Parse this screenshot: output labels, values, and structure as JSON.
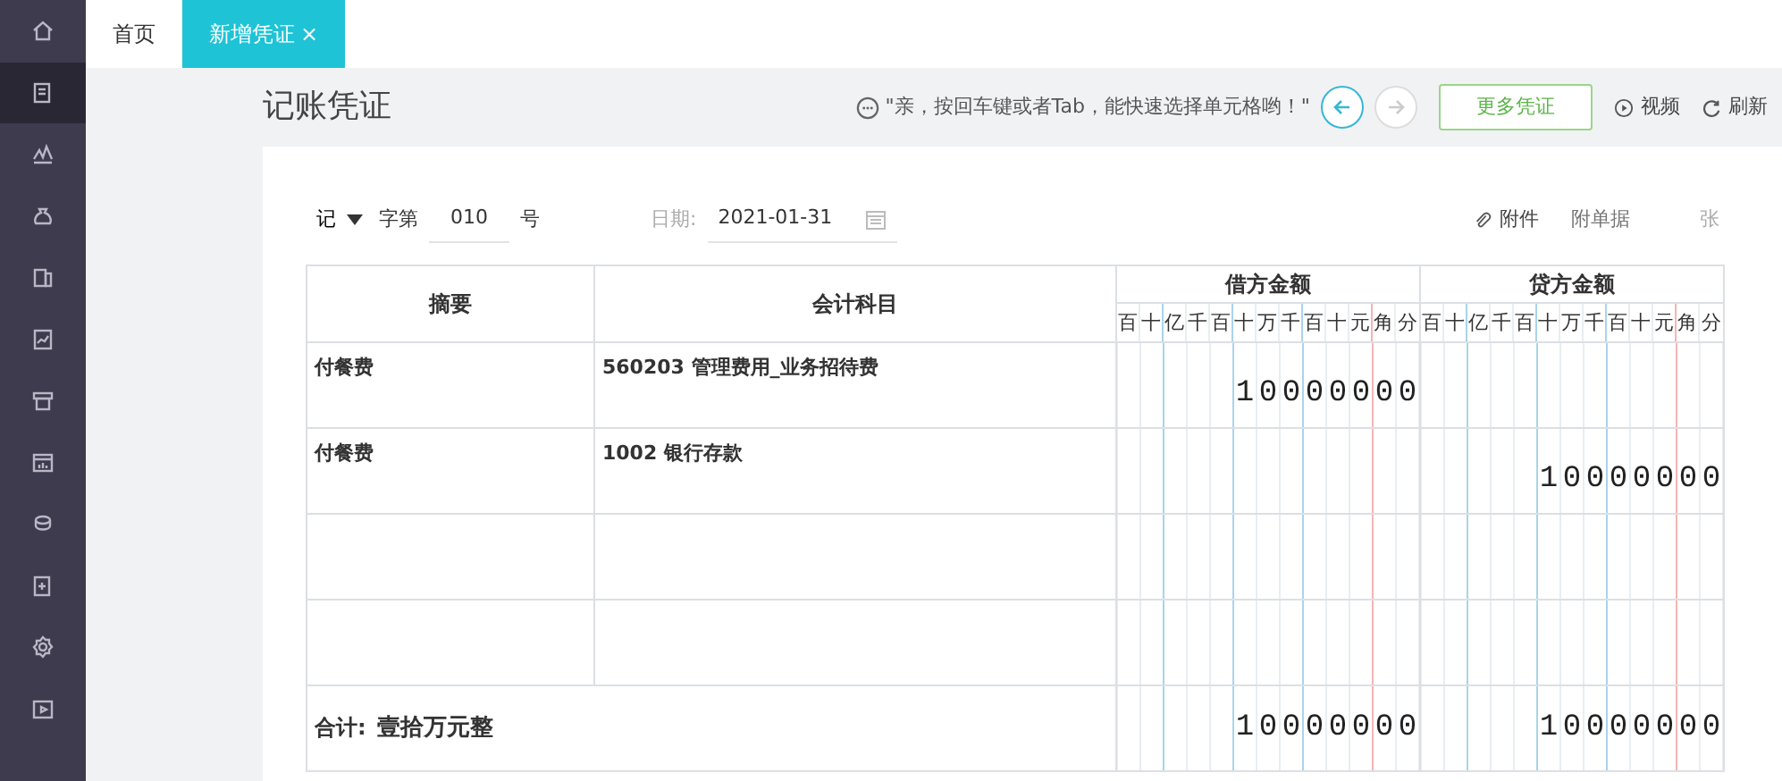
{
  "sidebar": {
    "items": [
      {
        "selected": false
      },
      {
        "selected": true
      },
      {
        "selected": false
      },
      {
        "selected": false
      },
      {
        "selected": false
      },
      {
        "selected": false
      },
      {
        "selected": false
      },
      {
        "selected": false
      },
      {
        "selected": false
      },
      {
        "selected": false
      },
      {
        "selected": false
      },
      {
        "selected": false
      }
    ]
  },
  "tabs": [
    {
      "label": "首页",
      "selected": false
    },
    {
      "label": "新增凭证",
      "selected": true,
      "close": "×"
    }
  ],
  "page_title": "记账凭证",
  "toolbar": {
    "hint": "\"亲，按回车键或者Tab，能快速选择单元格哟！\"",
    "prev_disabled": false,
    "next_disabled": true,
    "more_button": "更多凭证",
    "video": "视频",
    "refresh": "刷新"
  },
  "form": {
    "voucher_type": "记",
    "prefix": "字第",
    "number": "010",
    "suffix": "号",
    "date_label": "日期:",
    "date": "2021-01-31",
    "attachment": "附件",
    "attach_placeholder": "附单据",
    "attach_unit": "张"
  },
  "table": {
    "columns": [
      "摘要",
      "会计科目",
      "借方金额",
      "贷方金额"
    ],
    "debit_units": [
      "百",
      "十",
      "亿",
      "千",
      "百",
      "十",
      "万",
      "千",
      "百",
      "十",
      "元",
      "角",
      "分"
    ],
    "credit_units": [
      "百",
      "十",
      "亿",
      "千",
      "百",
      "十",
      "万",
      "千",
      "百",
      "十",
      "元",
      "角",
      "分"
    ],
    "rows": [
      {
        "summary": "付餐费",
        "account": "560203 管理费用_业务招待费",
        "debit": "10000000"
      },
      {
        "summary": "付餐费",
        "account": "1002 银行存款",
        "credit": "10000000"
      },
      {},
      {}
    ],
    "total": {
      "label": "合计:",
      "words": "壹拾万元整",
      "debit": "10000000",
      "credit": "10000000"
    }
  }
}
